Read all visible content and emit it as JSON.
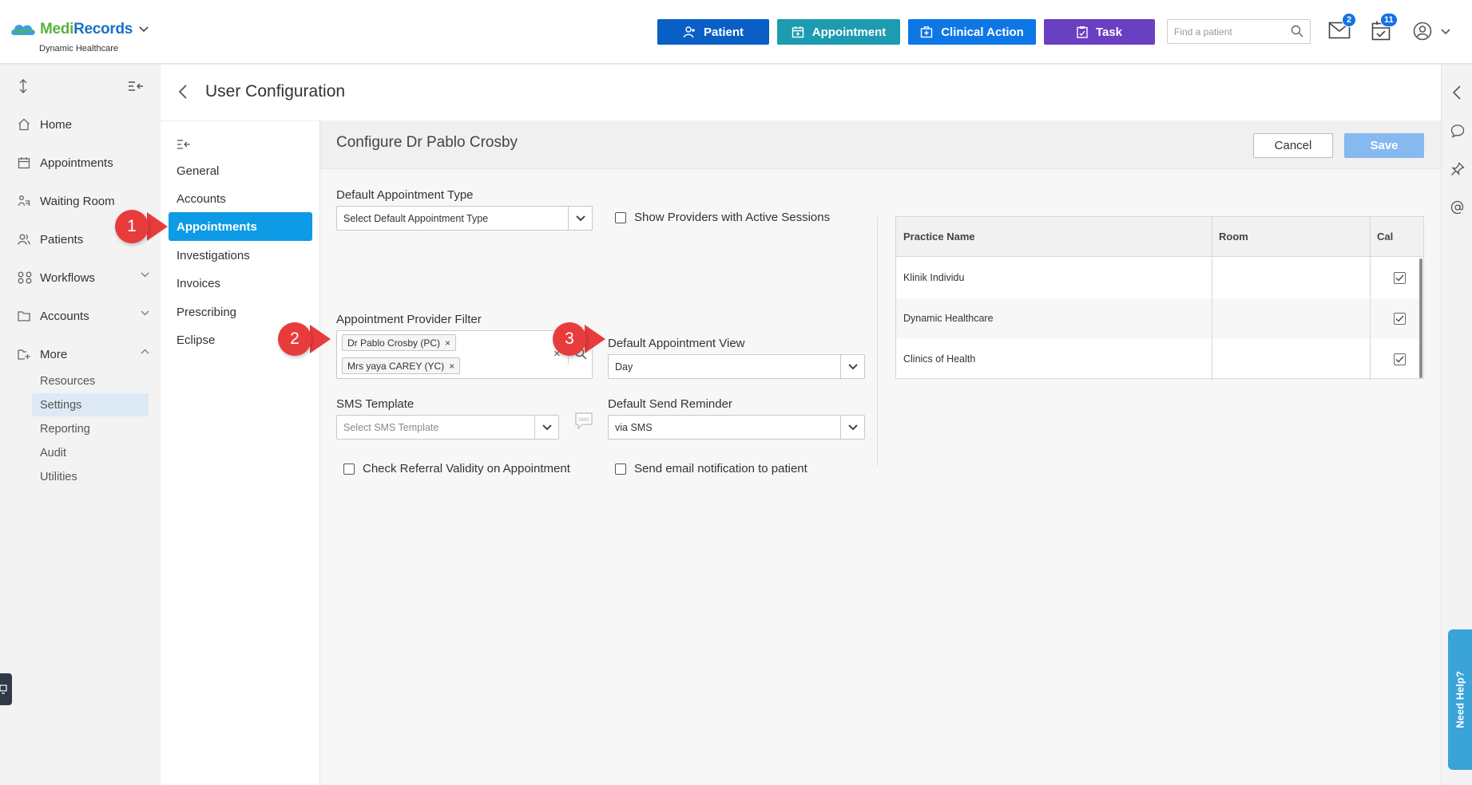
{
  "brand": {
    "name_part1": "Medi",
    "name_part2": "Records",
    "subtitle": "Dynamic Healthcare",
    "colors": {
      "green": "#5bb33b",
      "blue": "#1a6fc4"
    }
  },
  "topbar": {
    "patient_label": "Patient",
    "appointment_label": "Appointment",
    "clinical_action_label": "Clinical Action",
    "task_label": "Task",
    "search_placeholder": "Find a patient",
    "messages_badge": "2",
    "calendar_badge": "11",
    "colors": {
      "patient": "#0a5fc6",
      "appointment": "#1d9bb0",
      "clinical": "#0d77e6",
      "task": "#6b3fc1"
    }
  },
  "sidebar": {
    "items": [
      {
        "label": "Home",
        "icon": "home-icon"
      },
      {
        "label": "Appointments",
        "icon": "calendar-icon"
      },
      {
        "label": "Waiting Room",
        "icon": "waiting-room-icon"
      },
      {
        "label": "Patients",
        "icon": "patients-icon"
      },
      {
        "label": "Workflows",
        "icon": "workflows-icon"
      },
      {
        "label": "Accounts",
        "icon": "folder-icon"
      },
      {
        "label": "More",
        "icon": "more-folder-icon"
      }
    ],
    "sub_items": [
      "Resources",
      "Settings",
      "Reporting",
      "Audit",
      "Utilities"
    ],
    "active_sub": "Settings"
  },
  "page": {
    "title": "User Configuration"
  },
  "subnav": {
    "items": [
      "General",
      "Accounts",
      "Appointments",
      "Investigations",
      "Invoices",
      "Prescribing",
      "Eclipse"
    ],
    "active": "Appointments"
  },
  "config": {
    "title": "Configure Dr Pablo Crosby",
    "cancel_label": "Cancel",
    "save_label": "Save",
    "default_appointment_type": {
      "label": "Default Appointment Type",
      "value": "Select Default Appointment Type"
    },
    "show_providers": {
      "label": "Show Providers with Active Sessions",
      "checked": false
    },
    "provider_filter": {
      "label": "Appointment Provider Filter",
      "chips": [
        "Dr Pablo Crosby (PC)",
        "Mrs yaya CAREY (YC)"
      ],
      "remove_glyph": "×",
      "clear_glyph": "×"
    },
    "default_view": {
      "label": "Default Appointment View",
      "value": "Day"
    },
    "sms_template": {
      "label": "SMS Template",
      "placeholder": "Select SMS Template"
    },
    "default_reminder": {
      "label": "Default Send Reminder",
      "value": "via SMS"
    },
    "check_referral": {
      "label": "Check Referral Validity on Appointment",
      "checked": false
    },
    "send_email": {
      "label": "Send email notification to patient",
      "checked": false
    }
  },
  "practice_table": {
    "headers": [
      "Practice Name",
      "Room",
      "Cal"
    ],
    "rows": [
      {
        "name": "Klinik Individu",
        "room": "",
        "cal": true
      },
      {
        "name": "Dynamic Healthcare",
        "room": "",
        "cal": true
      },
      {
        "name": "Clinics of Health",
        "room": "",
        "cal": true
      }
    ]
  },
  "callouts": [
    "1",
    "2",
    "3"
  ],
  "sms_icon_text": "SMS",
  "help_tab": "Need Help?"
}
